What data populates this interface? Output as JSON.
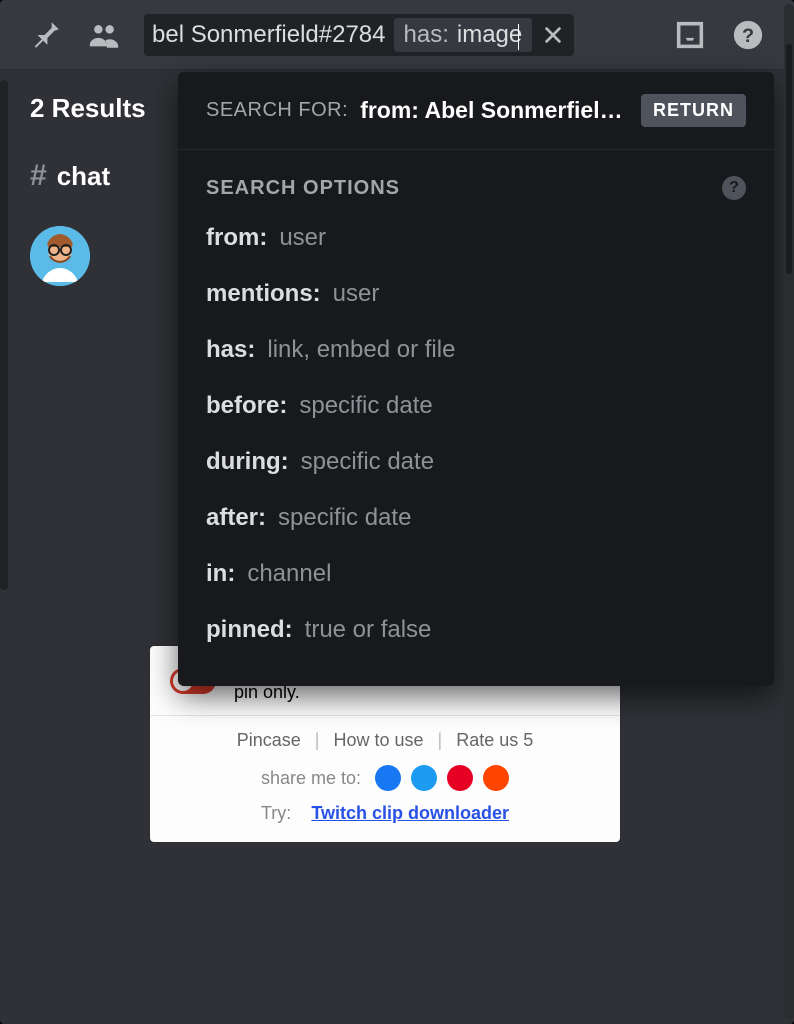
{
  "topbar": {
    "search_trunc_text": "bel Sonmerfield#2784",
    "chip_key": "has:",
    "chip_value": "image"
  },
  "results": {
    "count_label": "2 Results"
  },
  "channel": {
    "hash": "#",
    "name": "chat"
  },
  "popover": {
    "search_for_label": "SEARCH FOR:",
    "query_display": "from: Abel Sonmerfield…",
    "return_label": "RETURN",
    "options_title": "SEARCH OPTIONS",
    "options": [
      {
        "k": "from:",
        "v": "user"
      },
      {
        "k": "mentions:",
        "v": "user"
      },
      {
        "k": "has:",
        "v": "link, embed or file"
      },
      {
        "k": "before:",
        "v": "specific date"
      },
      {
        "k": "during:",
        "v": "specific date"
      },
      {
        "k": "after:",
        "v": "specific date"
      },
      {
        "k": "in:",
        "v": "channel"
      },
      {
        "k": "pinned:",
        "v": "true or false"
      }
    ]
  },
  "embed": {
    "toggle_text": "Simplify display. Show buttons on selected pin only.",
    "links": [
      "Pincase",
      "How to use",
      "Rate us 5"
    ],
    "share_label": "share me to:",
    "try_label": "Try:",
    "try_link": "Twitch clip downloader"
  }
}
